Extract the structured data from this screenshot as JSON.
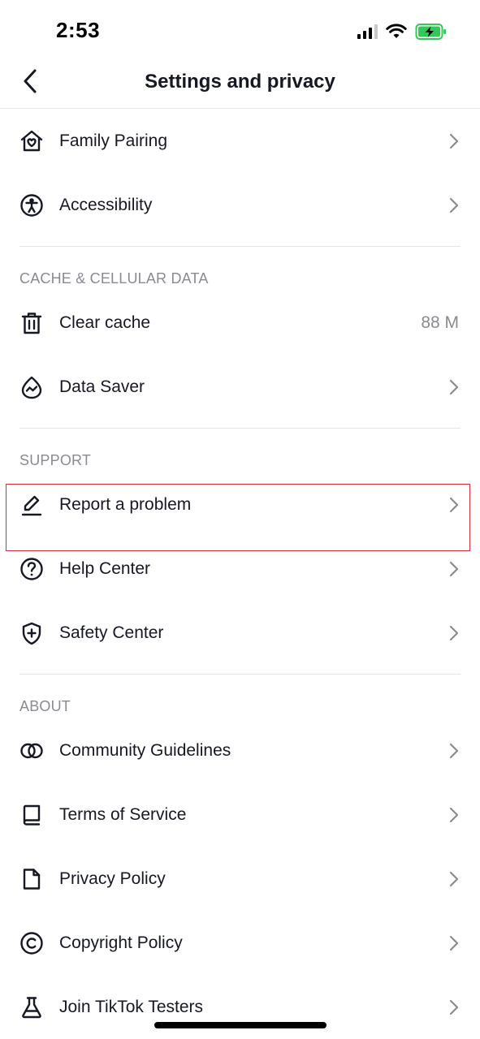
{
  "status_bar": {
    "time": "2:53"
  },
  "header": {
    "title": "Settings and privacy"
  },
  "rows_top": [
    {
      "label": "Family Pairing",
      "icon": "family-pairing-icon"
    },
    {
      "label": "Accessibility",
      "icon": "accessibility-icon"
    }
  ],
  "sections": {
    "cache": {
      "title": "CACHE & CELLULAR DATA",
      "items": [
        {
          "label": "Clear cache",
          "value": "88 M",
          "icon": "trash-icon"
        },
        {
          "label": "Data Saver",
          "icon": "data-saver-icon"
        }
      ]
    },
    "support": {
      "title": "SUPPORT",
      "items": [
        {
          "label": "Report a problem",
          "icon": "edit-pencil-icon"
        },
        {
          "label": "Help Center",
          "icon": "help-circle-icon"
        },
        {
          "label": "Safety Center",
          "icon": "shield-plus-icon"
        }
      ]
    },
    "about": {
      "title": "ABOUT",
      "items": [
        {
          "label": "Community Guidelines",
          "icon": "community-rings-icon"
        },
        {
          "label": "Terms of Service",
          "icon": "book-icon"
        },
        {
          "label": "Privacy Policy",
          "icon": "document-icon"
        },
        {
          "label": "Copyright Policy",
          "icon": "copyright-icon"
        },
        {
          "label": "Join TikTok Testers",
          "icon": "flask-icon"
        }
      ]
    }
  },
  "colors": {
    "text": "#161823",
    "secondary": "#8a8b91",
    "divider": "#e5e5e5",
    "highlight": "#d0313c",
    "battery": "#34c759"
  }
}
